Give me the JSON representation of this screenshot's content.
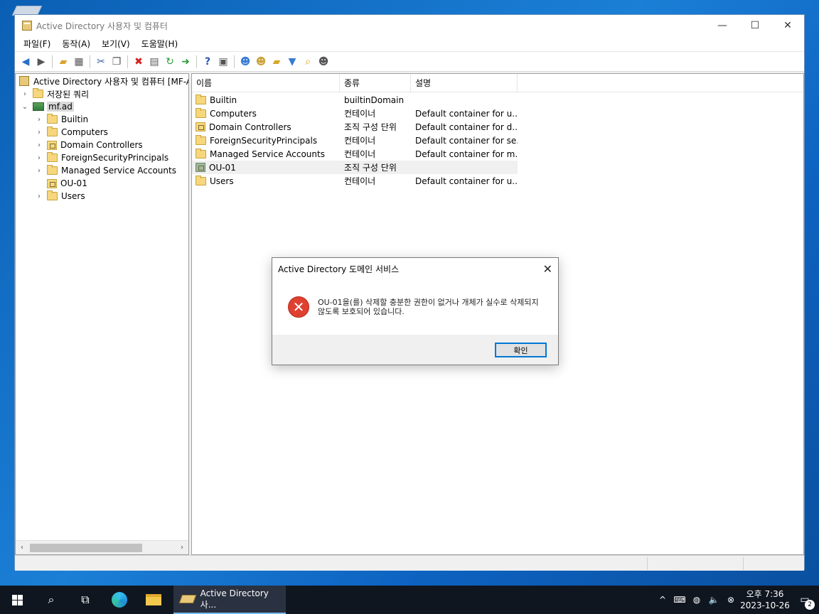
{
  "window": {
    "title": "Active Directory 사용자 및 컴퓨터",
    "minimize": "—",
    "maximize": "☐",
    "close": "✕"
  },
  "menu": [
    "파일(F)",
    "동작(A)",
    "보기(V)",
    "도움말(H)"
  ],
  "tree": {
    "root": "Active Directory 사용자 및 컴퓨터 [MF-A",
    "saved_queries": "저장된 쿼리",
    "domain": "mf.ad",
    "children": [
      {
        "label": "Builtin",
        "type": "folder",
        "expandable": true
      },
      {
        "label": "Computers",
        "type": "folder",
        "expandable": true
      },
      {
        "label": "Domain Controllers",
        "type": "ou",
        "expandable": true
      },
      {
        "label": "ForeignSecurityPrincipals",
        "type": "folder",
        "expandable": true
      },
      {
        "label": "Managed Service Accounts",
        "type": "folder",
        "expandable": true
      },
      {
        "label": "OU-01",
        "type": "ou",
        "expandable": false
      },
      {
        "label": "Users",
        "type": "folder",
        "expandable": true
      }
    ]
  },
  "list": {
    "headers": [
      "이름",
      "종류",
      "설명"
    ],
    "rows": [
      {
        "name": "Builtin",
        "type": "builtinDomain",
        "desc": "",
        "icon": "folder"
      },
      {
        "name": "Computers",
        "type": "컨테이너",
        "desc": "Default container for u...",
        "icon": "folder"
      },
      {
        "name": "Domain Controllers",
        "type": "조직 구성 단위",
        "desc": "Default container for d...",
        "icon": "ou"
      },
      {
        "name": "ForeignSecurityPrincipals",
        "type": "컨테이너",
        "desc": "Default container for se...",
        "icon": "folder"
      },
      {
        "name": "Managed Service Accounts",
        "type": "컨테이너",
        "desc": "Default container for m...",
        "icon": "folder"
      },
      {
        "name": "OU-01",
        "type": "조직 구성 단위",
        "desc": "",
        "icon": "ou-selected"
      },
      {
        "name": "Users",
        "type": "컨테이너",
        "desc": "Default container for u...",
        "icon": "folder"
      }
    ]
  },
  "dialog": {
    "title": "Active Directory 도메인 서비스",
    "message": "OU-01을(를) 삭제할 충분한 권한이 없거나 개체가 실수로 삭제되지 않도록 보호되어 있습니다.",
    "ok": "확인",
    "close": "✕"
  },
  "taskbar": {
    "app_label": "Active Directory 사...",
    "time": "오후 7:36",
    "date": "2023-10-26",
    "notifications": "2"
  }
}
